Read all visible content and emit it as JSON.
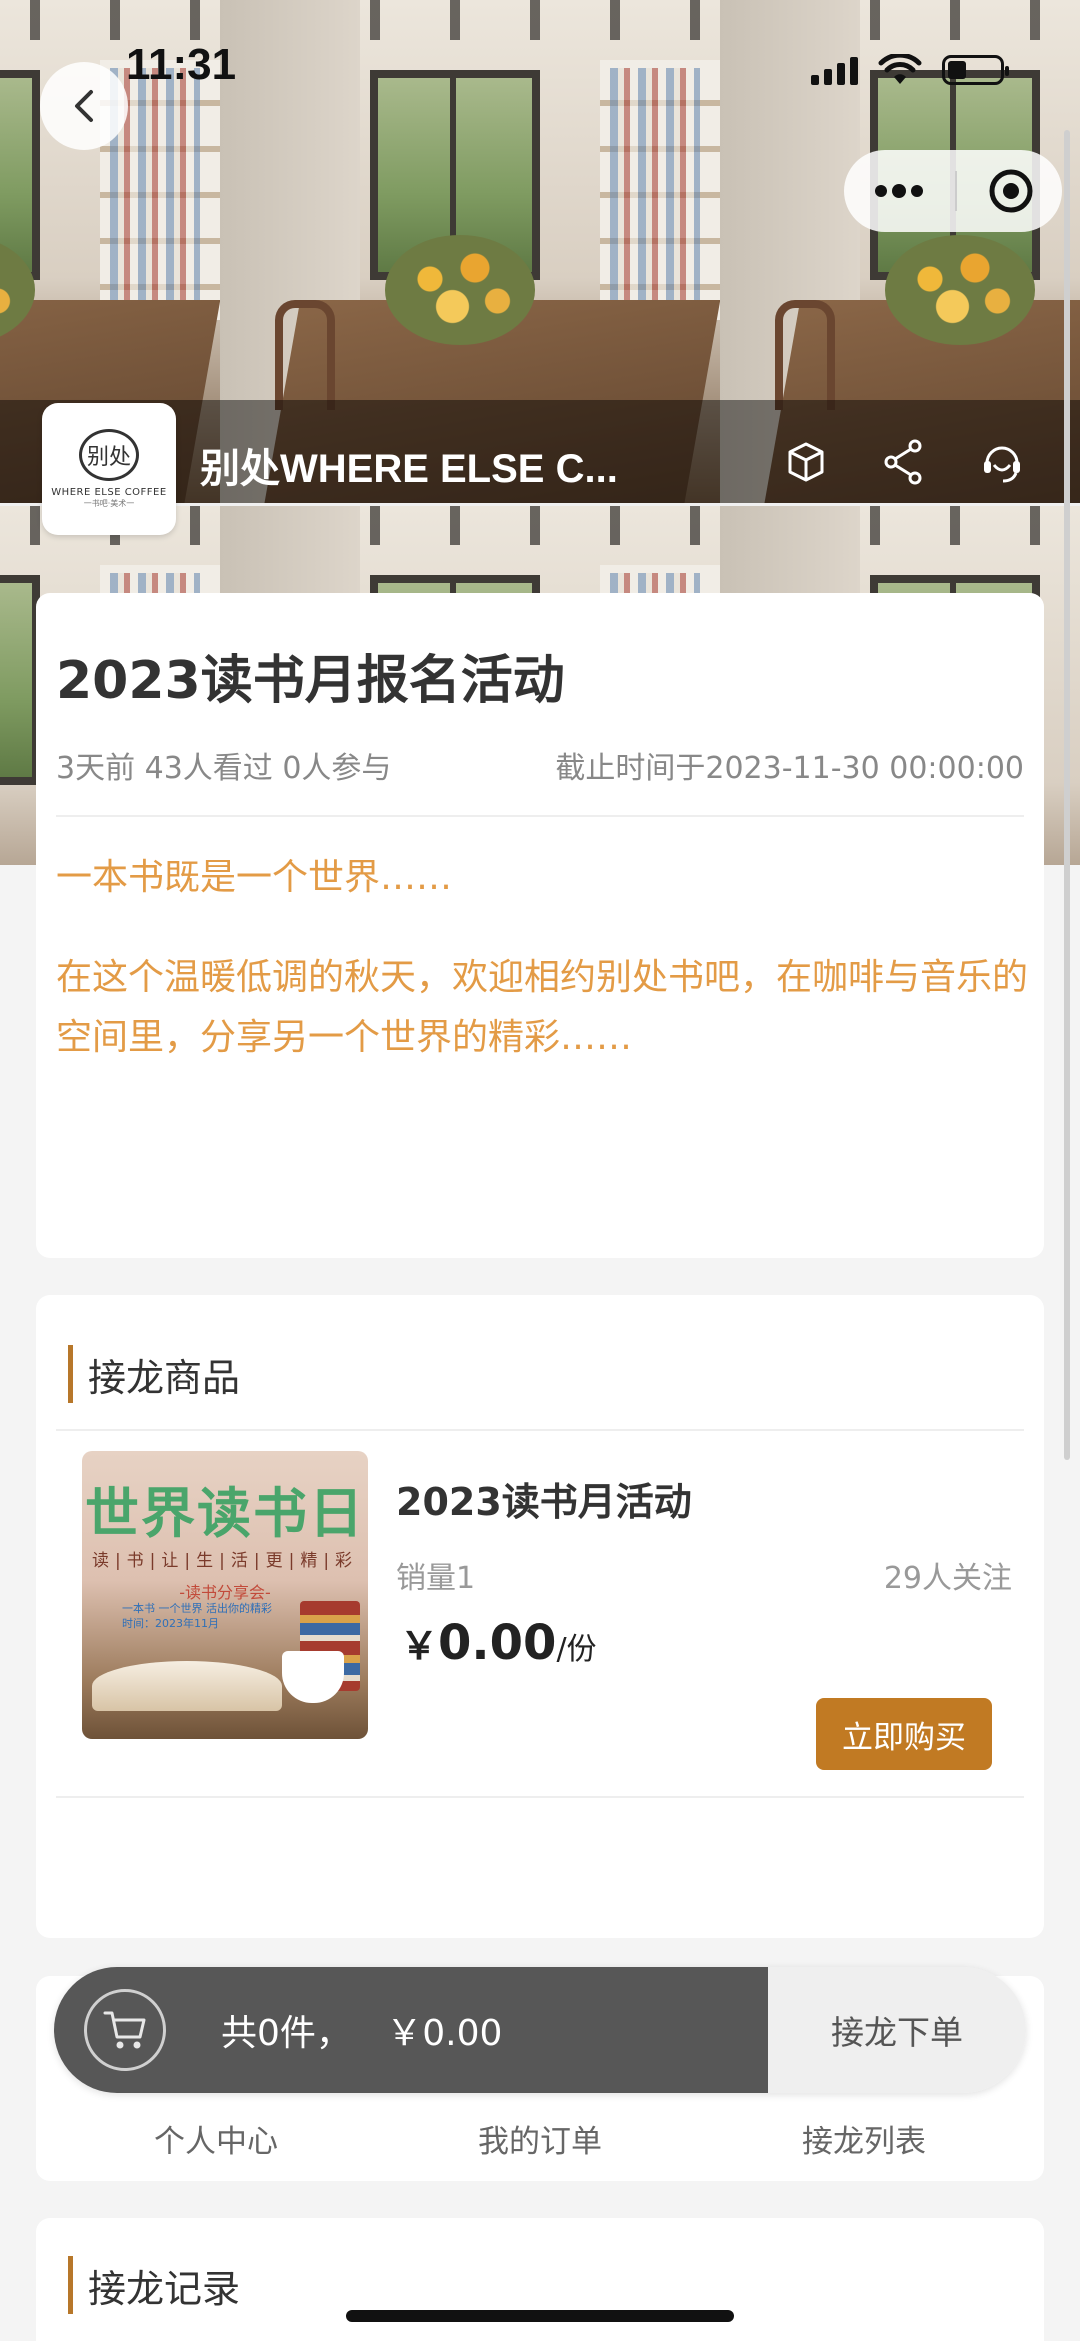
{
  "status_bar": {
    "time": "11:31"
  },
  "header": {
    "shop_name": "别处WHERE ELSE C...",
    "logo": {
      "mark": "别处",
      "text": "WHERE ELSE COFFEE",
      "sub": "一书吧·美术一"
    }
  },
  "activity": {
    "title": "2023读书月报名活动",
    "meta": "3天前 43人看过 0人参与",
    "deadline": "截止时间于2023-11-30 00:00:00",
    "line1": "一本书既是一个世界……",
    "paragraph": "在这个温暖低调的秋天，欢迎相约别处书吧，在咖啡与音乐的空间里，分享另一个世界的精彩……"
  },
  "goods_section": {
    "heading": "接龙商品",
    "item": {
      "image": {
        "title": "世界读书日",
        "subtitle": "读|书|让|生|活|更|精|彩",
        "event": "-读书分享会-",
        "line_a": "一本书 一个世界 活出你的精彩",
        "line_b": "时间：2023年11月"
      },
      "name": "2023读书月活动",
      "sales": "销量1",
      "followers": "29人关注",
      "currency": "￥",
      "price": "0.00",
      "unit": "/份",
      "buy_label": "立即购买"
    }
  },
  "order_bar": {
    "total": "共0件，   ￥0.00",
    "submit_label": "接龙下单"
  },
  "tabs": [
    {
      "label": "个人中心"
    },
    {
      "label": "我的订单"
    },
    {
      "label": "接龙列表"
    }
  ],
  "records_section": {
    "heading": "接龙记录"
  },
  "colors": {
    "accent": "#c17a23",
    "text_orange": "#e39b46",
    "bar_dark": "#575757"
  }
}
